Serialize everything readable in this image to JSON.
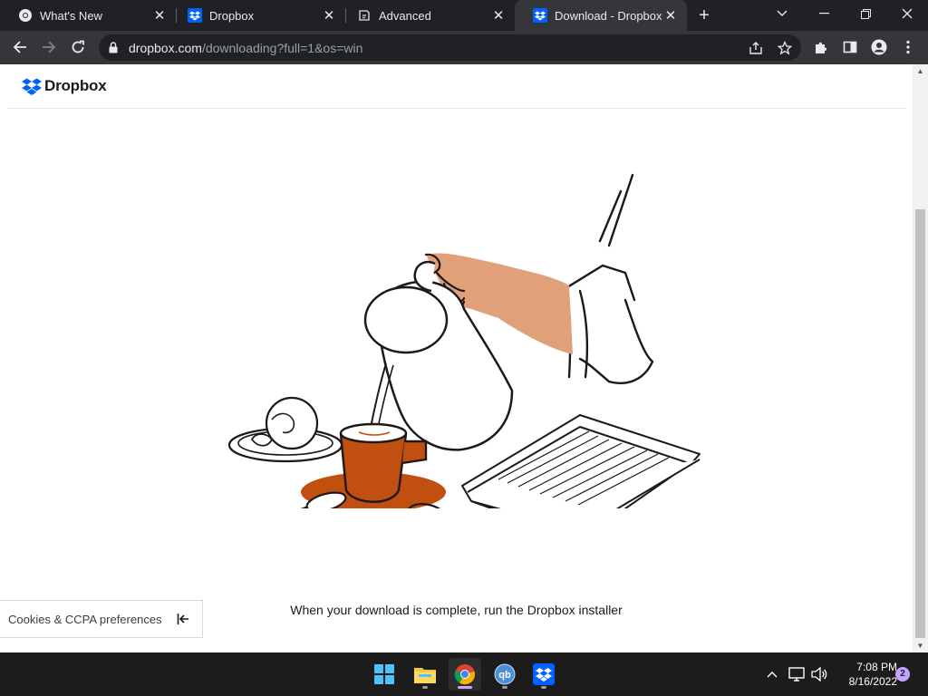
{
  "browser": {
    "tabs": [
      {
        "title": "What's New",
        "icon": "chrome-icon",
        "active": false
      },
      {
        "title": "Dropbox",
        "icon": "dropbox-icon",
        "active": false
      },
      {
        "title": "Advanced",
        "icon": "settings-site-icon",
        "active": false
      },
      {
        "title": "Download - Dropbox",
        "icon": "dropbox-icon",
        "active": true
      }
    ],
    "tab_close": "✕",
    "new_tab": "+",
    "url_host": "dropbox.com",
    "url_path": "/downloading?full=1&os=win"
  },
  "page": {
    "logo_text": "Dropbox",
    "message": "When your download is complete, run the Dropbox installer",
    "cookies_label": "Cookies & CCPA preferences"
  },
  "taskbar": {
    "apps": [
      "start-icon",
      "file-explorer-icon",
      "chrome-icon",
      "qbittorrent-icon",
      "dropbox-icon"
    ],
    "qb_text": "qb",
    "time": "7:08 PM",
    "date": "8/16/2022",
    "notification_count": "2"
  },
  "colors": {
    "dropbox_blue": "#0061fe",
    "accent_orange": "#c14f10",
    "skin": "#e0a07a"
  }
}
